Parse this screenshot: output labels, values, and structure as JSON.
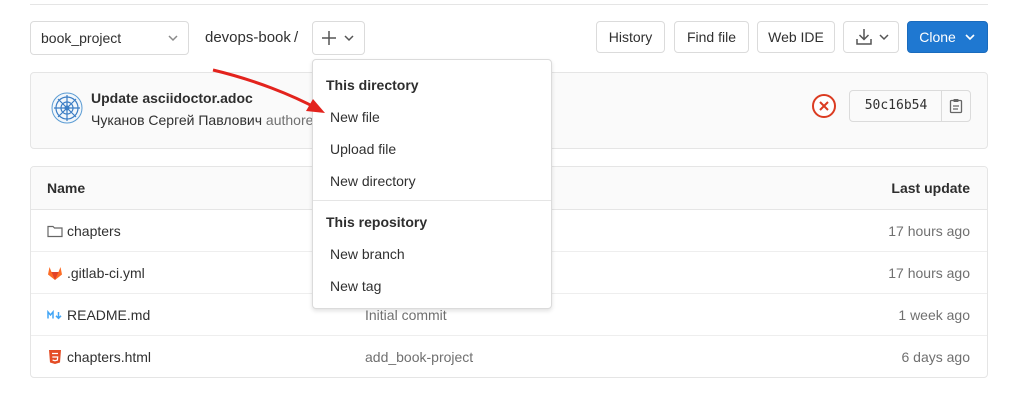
{
  "toolbar": {
    "project_select": "book_project",
    "breadcrumb": "devops-book",
    "separator": "/",
    "add_icon": "plus-icon",
    "history_label": "History",
    "find_file_label": "Find file",
    "web_ide_label": "Web IDE",
    "download_icon": "download-icon",
    "clone_label": "Clone",
    "clone_color": "#1f78d1"
  },
  "commit": {
    "title": "Update asciidoctor.adoc",
    "author": "Чуканов Сергей Павлович",
    "author_suffix": "authore",
    "status_icon": "status-failed-icon",
    "status_color": "#db3b21",
    "sha": "50c16b54",
    "copy_icon": "clipboard-icon"
  },
  "dropdown": {
    "section1": "This directory",
    "items1": [
      "New file",
      "Upload file",
      "New directory"
    ],
    "section2": "This repository",
    "items2": [
      "New branch",
      "New tag"
    ]
  },
  "table": {
    "headers": {
      "name": "Name",
      "last_update": "Last update"
    },
    "rows": [
      {
        "icon": "folder-icon",
        "name": "chapters",
        "message": "",
        "updated": "17 hours ago"
      },
      {
        "icon": "gitlab-icon",
        "name": ".gitlab-ci.yml",
        "message": "",
        "updated": "17 hours ago"
      },
      {
        "icon": "markdown-icon",
        "name": "README.md",
        "message": "Initial commit",
        "updated": "1 week ago"
      },
      {
        "icon": "html5-icon",
        "name": "chapters.html",
        "message": "add_book-project",
        "updated": "6 days ago"
      }
    ]
  },
  "annotation": {
    "arrow_color": "#e3231d"
  }
}
